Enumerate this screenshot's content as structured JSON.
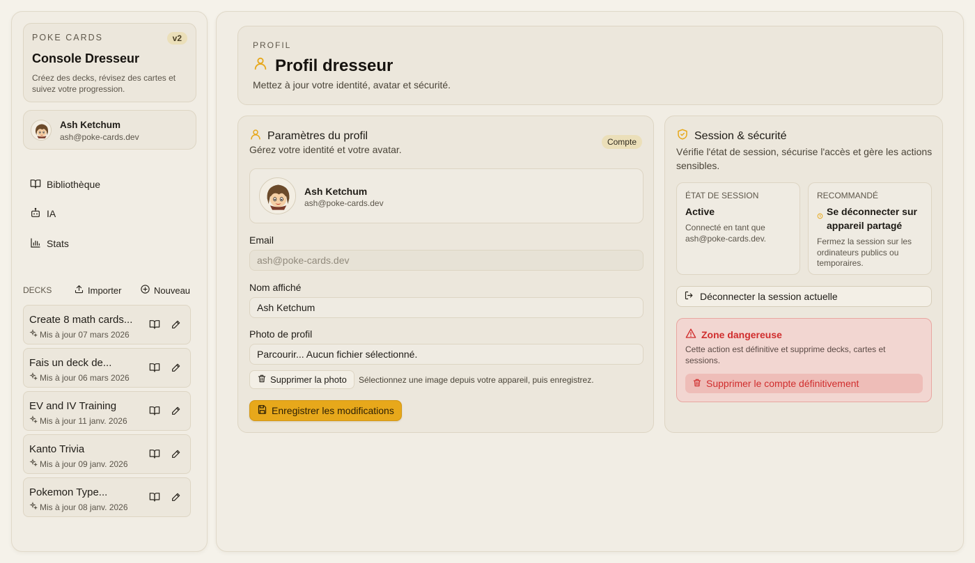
{
  "brand": {
    "eyebrow": "POKE CARDS",
    "version": "v2",
    "title": "Console Dresseur",
    "description": "Créez des decks, révisez des cartes et suivez votre progression."
  },
  "user": {
    "name": "Ash Ketchum",
    "email": "ash@poke-cards.dev"
  },
  "nav": {
    "items": [
      {
        "label": "Bibliothèque",
        "icon": "book-open-icon"
      },
      {
        "label": "IA",
        "icon": "bot-icon"
      },
      {
        "label": "Stats",
        "icon": "bar-chart-icon"
      }
    ]
  },
  "decks": {
    "label": "DECKS",
    "import_label": "Importer",
    "new_label": "Nouveau",
    "items": [
      {
        "title": "Create 8 math cards...",
        "updated": "Mis à jour 07 mars 2026"
      },
      {
        "title": "Fais un deck de...",
        "updated": "Mis à jour 06 mars 2026"
      },
      {
        "title": "EV and IV Training",
        "updated": "Mis à jour 11 janv. 2026"
      },
      {
        "title": "Kanto Trivia",
        "updated": "Mis à jour 09 janv. 2026"
      },
      {
        "title": "Pokemon Type...",
        "updated": "Mis à jour 08 janv. 2026"
      }
    ]
  },
  "header": {
    "eyebrow": "PROFIL",
    "title": "Profil dresseur",
    "subtitle": "Mettez à jour votre identité, avatar et sécurité."
  },
  "profile_panel": {
    "title": "Paramètres du profil",
    "subtitle": "Gérez votre identité et votre avatar.",
    "badge": "Compte",
    "email_label": "Email",
    "email_value": "ash@poke-cards.dev",
    "display_name_label": "Nom affiché",
    "display_name_value": "Ash Ketchum",
    "photo_label": "Photo de profil",
    "photo_value": "Parcourir... Aucun fichier sélectionné.",
    "remove_photo_label": "Supprimer la photo",
    "photo_help": "Sélectionnez une image depuis votre appareil, puis enregistrez.",
    "save_label": "Enregistrer les modifications"
  },
  "security_panel": {
    "title": "Session & sécurité",
    "subtitle": "Vérifie l'état de session, sécurise l'accès et gère les actions sensibles.",
    "session_state": {
      "eyebrow": "ÉTAT DE SESSION",
      "value": "Active",
      "desc": "Connecté en tant que ash@poke-cards.dev."
    },
    "recommended": {
      "eyebrow": "RECOMMANDÉ",
      "value": "Se déconnecter sur appareil partagé",
      "desc": "Fermez la session sur les ordinateurs publics ou temporaires."
    },
    "logout_label": "Déconnecter la session actuelle",
    "danger": {
      "title": "Zone dangereuse",
      "desc": "Cette action est définitive et supprime decks, cartes et sessions.",
      "button": "Supprimer le compte définitivement"
    }
  },
  "colors": {
    "accent": "#e7a81b",
    "danger": "#d02d2d",
    "background": "#f5f2ea"
  }
}
